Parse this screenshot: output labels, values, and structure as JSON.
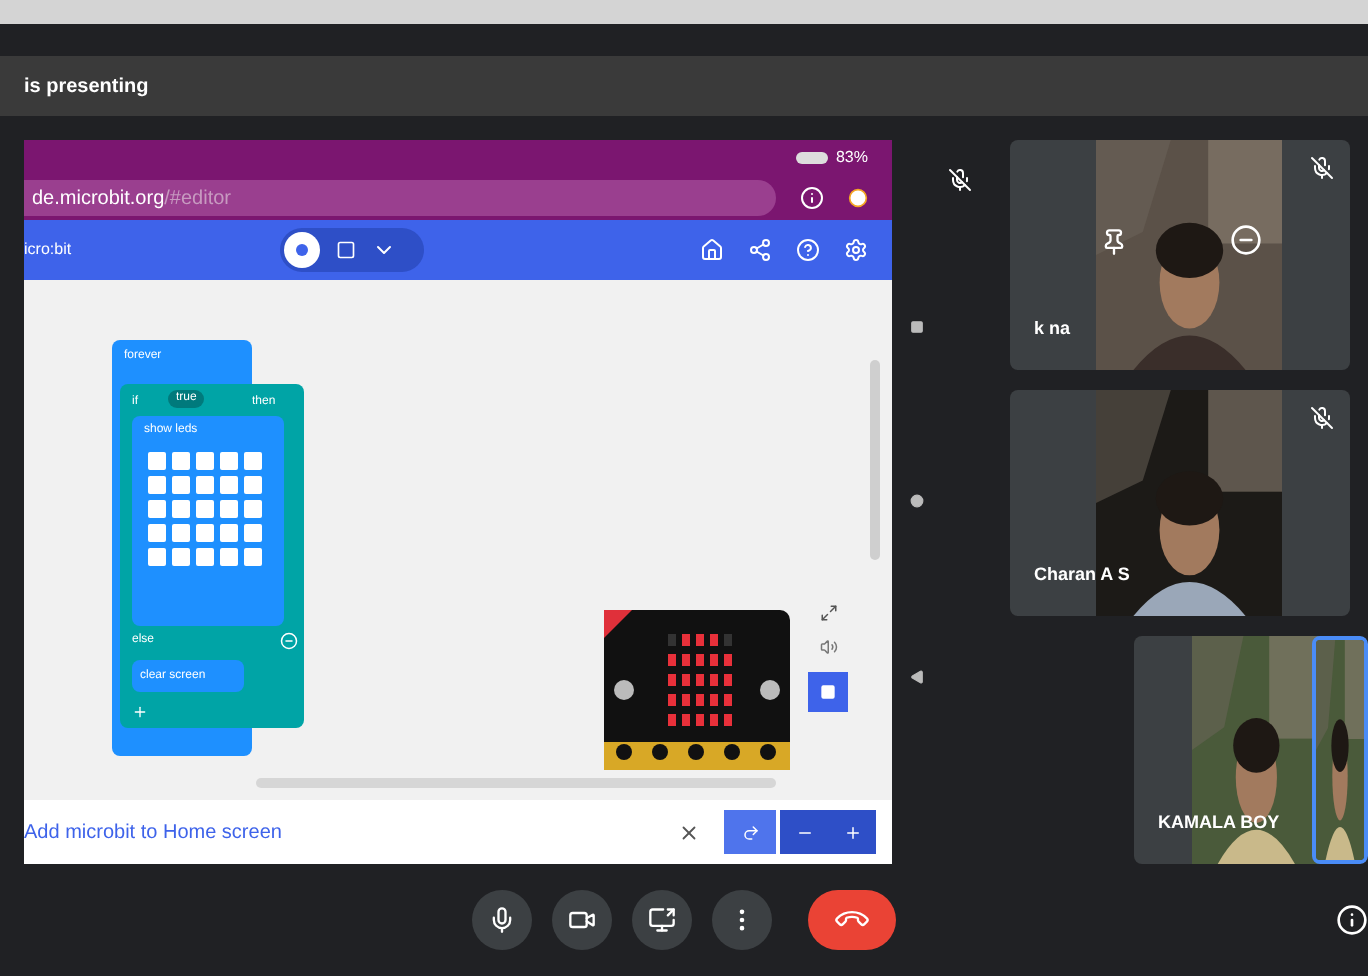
{
  "presenting": {
    "text": "is presenting",
    "muted": true
  },
  "phone": {
    "battery": "83%",
    "url_host": "de.microbit.org",
    "url_path": "/#editor",
    "brand": "icro:bit",
    "blocks": {
      "forever": "forever",
      "if": "if",
      "condition": "true",
      "then": "then",
      "show_leds": "show leds",
      "else": "else",
      "clear": "clear screen"
    },
    "banner": "Add microbit to Home screen"
  },
  "participants": [
    {
      "name": "k na",
      "muted": true
    },
    {
      "name": "Charan A S",
      "muted": true
    },
    {
      "name": "KAMALA BOY",
      "muted": false
    }
  ],
  "controls": [
    {
      "kind": "mic"
    },
    {
      "kind": "camera"
    },
    {
      "kind": "present"
    },
    {
      "kind": "more"
    },
    {
      "kind": "end"
    }
  ]
}
